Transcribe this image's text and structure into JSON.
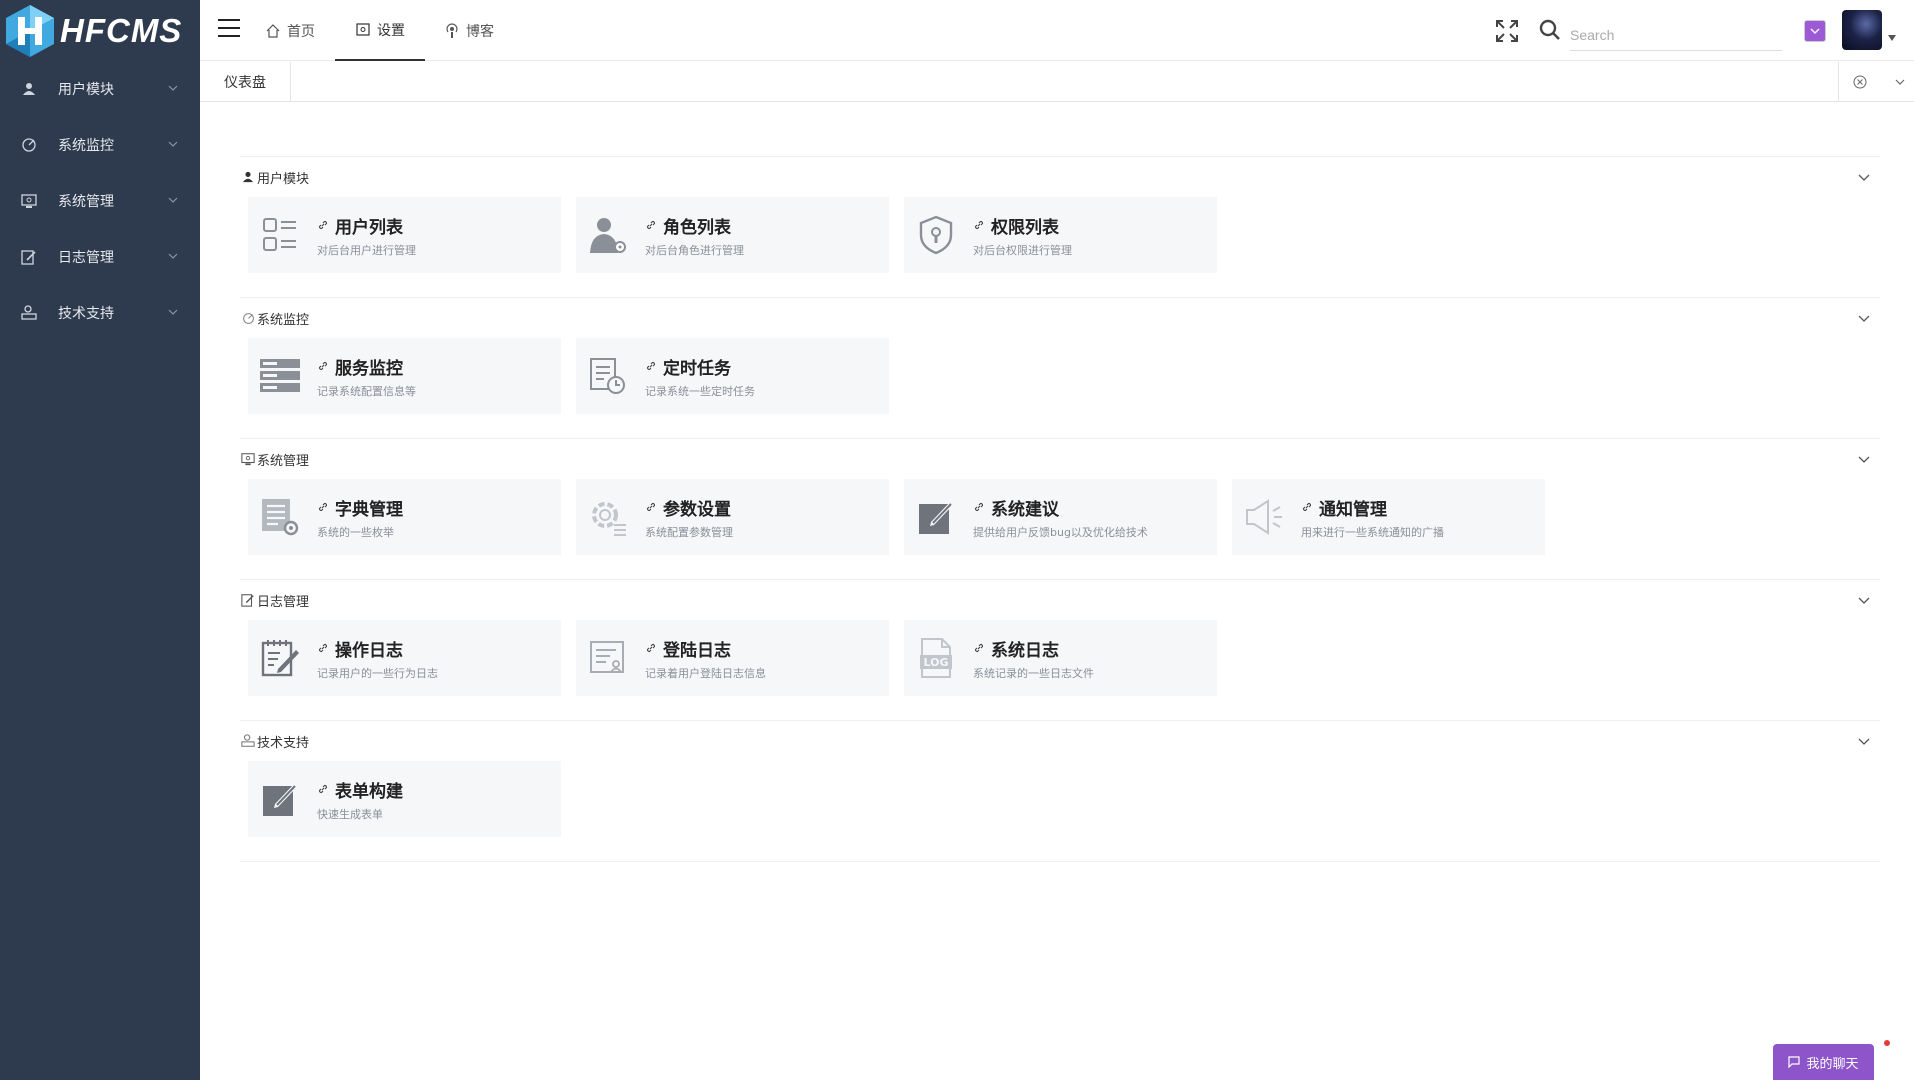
{
  "app": {
    "logo_text": "HFCMS",
    "brand_color": "#2e3a4d",
    "accent_color": "#8d55c9"
  },
  "sidebar": {
    "items": [
      {
        "label": "用户模块",
        "icon": "user-icon"
      },
      {
        "label": "系统监控",
        "icon": "monitor-icon"
      },
      {
        "label": "系统管理",
        "icon": "system-icon"
      },
      {
        "label": "日志管理",
        "icon": "log-icon"
      },
      {
        "label": "技术支持",
        "icon": "support-icon"
      }
    ]
  },
  "header": {
    "tabs": [
      {
        "label": "首页",
        "icon": "home-icon",
        "active": false
      },
      {
        "label": "设置",
        "icon": "settings-icon",
        "active": true
      },
      {
        "label": "博客",
        "icon": "podcast-icon",
        "active": false
      }
    ],
    "search_placeholder": "Search"
  },
  "tabsbar": {
    "open_tabs": [
      {
        "label": "仪表盘"
      }
    ]
  },
  "groups": [
    {
      "title": "用户模块",
      "icon": "user-icon",
      "cards": [
        {
          "title": "用户列表",
          "desc": "对后台用户进行管理",
          "icon": "list-icon"
        },
        {
          "title": "角色列表",
          "desc": "对后台角色进行管理",
          "icon": "user-gear-icon"
        },
        {
          "title": "权限列表",
          "desc": "对后台权限进行管理",
          "icon": "shield-icon"
        }
      ]
    },
    {
      "title": "系统监控",
      "icon": "monitor-icon",
      "cards": [
        {
          "title": "服务监控",
          "desc": "记录系统配置信息等",
          "icon": "server-icon"
        },
        {
          "title": "定时任务",
          "desc": "记录系统一些定时任务",
          "icon": "clock-doc-icon"
        }
      ]
    },
    {
      "title": "系统管理",
      "icon": "system-icon",
      "cards": [
        {
          "title": "字典管理",
          "desc": "系统的一些枚举",
          "icon": "dictionary-icon"
        },
        {
          "title": "参数设置",
          "desc": "系统配置参数管理",
          "icon": "gear-icon"
        },
        {
          "title": "系统建议",
          "desc": "提供给用户反馈bug以及优化给技术",
          "icon": "edit-icon"
        },
        {
          "title": "通知管理",
          "desc": "用来进行一些系统通知的广播",
          "icon": "speaker-icon"
        }
      ]
    },
    {
      "title": "日志管理",
      "icon": "log-icon",
      "cards": [
        {
          "title": "操作日志",
          "desc": "记录用户的一些行为日志",
          "icon": "notepad-icon"
        },
        {
          "title": "登陆日志",
          "desc": "记录着用户登陆日志信息",
          "icon": "login-doc-icon"
        },
        {
          "title": "系统日志",
          "desc": "系统记录的一些日志文件",
          "icon": "log-file-icon"
        }
      ]
    },
    {
      "title": "技术支持",
      "icon": "support-icon",
      "cards": [
        {
          "title": "表单构建",
          "desc": "快速生成表单",
          "icon": "edit-icon"
        }
      ]
    }
  ],
  "chat": {
    "label": "我的聊天"
  }
}
